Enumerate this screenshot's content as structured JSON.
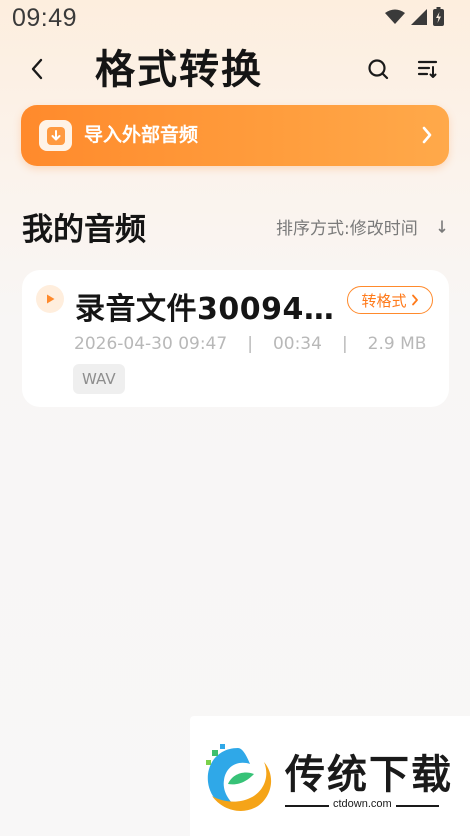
{
  "status_bar": {
    "time": "09:49"
  },
  "header": {
    "title": "格式转换"
  },
  "import_bar": {
    "label": "导入外部音频"
  },
  "section": {
    "title": "我的音频",
    "sort_label": "排序方式:修改时间"
  },
  "files": [
    {
      "name": "录音文件30094…",
      "date": "2026-04-30 09:47",
      "duration": "00:34",
      "size": "2.9 MB",
      "format": "WAV",
      "separator": "|",
      "action_label": "转格式"
    }
  ],
  "watermark": {
    "text": "传统下载",
    "url": "ctdown.com"
  },
  "colors": {
    "accent": "#ff8a2c",
    "text": "#151515",
    "muted": "#b8b8b8"
  }
}
